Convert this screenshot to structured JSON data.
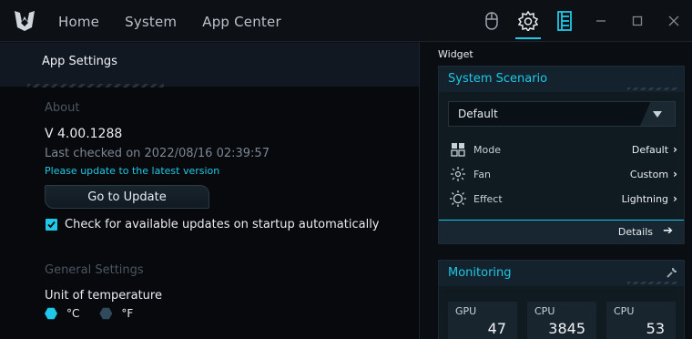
{
  "nav": {
    "items": [
      "Home",
      "System",
      "App Center"
    ]
  },
  "left": {
    "title": "App Settings",
    "about": {
      "heading": "About",
      "version": "V 4.00.1288",
      "last_checked": "Last checked on 2022/08/16 02:39:57",
      "update_note": "Please update to the latest version",
      "update_button": "Go to Update",
      "auto_check_label": "Check for available updates on startup automatically",
      "auto_check_enabled": true
    },
    "general": {
      "heading": "General Settings",
      "unit_label": "Unit of temperature",
      "units": [
        {
          "label": "°C",
          "selected": true
        },
        {
          "label": "°F",
          "selected": false
        }
      ]
    }
  },
  "widget": {
    "label": "Widget",
    "scenario": {
      "title": "System Scenario",
      "selected": "Default",
      "rows": [
        {
          "icon": "mode-icon",
          "name": "Mode",
          "value": "Default"
        },
        {
          "icon": "fan-icon",
          "name": "Fan",
          "value": "Custom"
        },
        {
          "icon": "effect-icon",
          "name": "Effect",
          "value": "Lightning"
        }
      ],
      "details_label": "Details"
    },
    "monitoring": {
      "title": "Monitoring",
      "tiles": [
        {
          "label": "GPU",
          "value": "47"
        },
        {
          "label": "CPU",
          "value": "3845"
        },
        {
          "label": "CPU",
          "value": "53"
        }
      ]
    }
  },
  "colors": {
    "accent": "#1fc8e8",
    "background": "#0b0f13"
  }
}
